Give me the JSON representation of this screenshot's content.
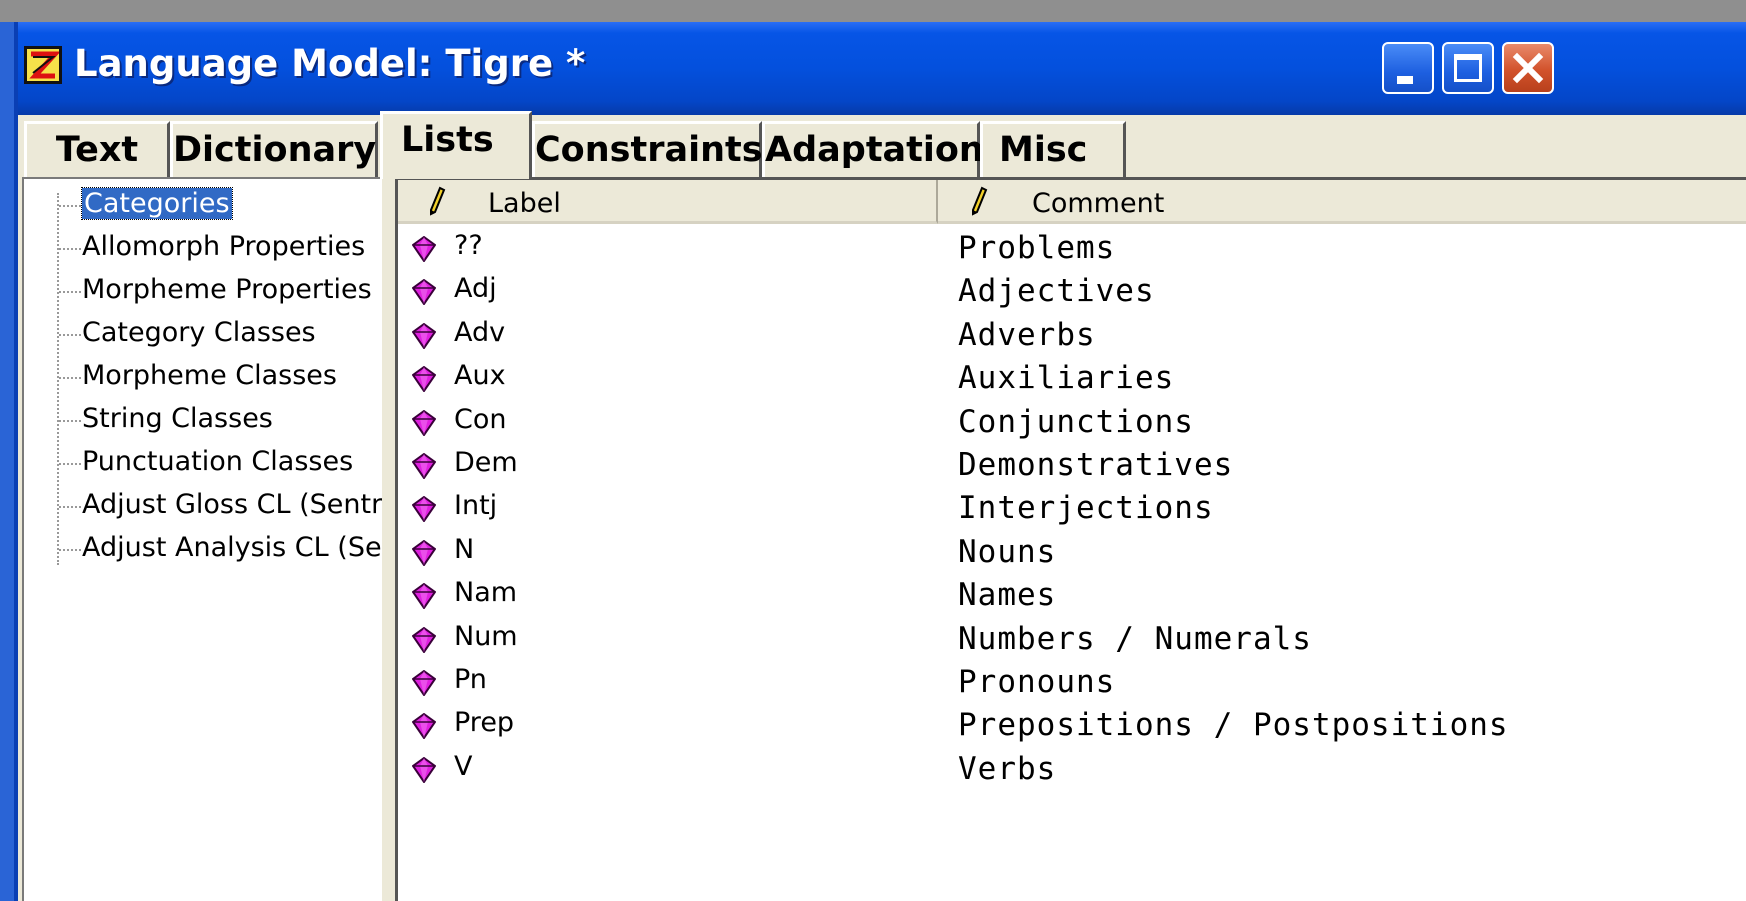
{
  "window": {
    "title": "Language Model: Tigre *",
    "buttons": {
      "minimize": "minimize",
      "maximize": "maximize",
      "close": "close"
    }
  },
  "tabs": [
    {
      "label": "Text",
      "active": false
    },
    {
      "label": "Dictionary",
      "active": false
    },
    {
      "label": "Lists",
      "active": true
    },
    {
      "label": "Constraints",
      "active": false
    },
    {
      "label": "Adaptation",
      "active": false
    },
    {
      "label": "Misc",
      "active": false
    }
  ],
  "tree": {
    "selected": "Categories",
    "items": [
      "Categories",
      "Allomorph Properties",
      "Morpheme Properties",
      "Category Classes",
      "Morpheme Classes",
      "String Classes",
      "Punctuation Classes",
      "Adjust Gloss CL (Sentra",
      "Adjust Analysis CL (Ser"
    ]
  },
  "list": {
    "columns": {
      "label": "Label",
      "comment": "Comment"
    },
    "rows": [
      {
        "label": "??",
        "comment": "Problems"
      },
      {
        "label": "Adj",
        "comment": "Adjectives"
      },
      {
        "label": "Adv",
        "comment": "Adverbs"
      },
      {
        "label": "Aux",
        "comment": "Auxiliaries"
      },
      {
        "label": "Con",
        "comment": "Conjunctions"
      },
      {
        "label": "Dem",
        "comment": "Demonstratives"
      },
      {
        "label": "Intj",
        "comment": "Interjections"
      },
      {
        "label": "N",
        "comment": "Nouns"
      },
      {
        "label": "Nam",
        "comment": "Names"
      },
      {
        "label": "Num",
        "comment": "Numbers / Numerals"
      },
      {
        "label": "Pn",
        "comment": "Pronouns"
      },
      {
        "label": "Prep",
        "comment": "Prepositions / Postpositions"
      },
      {
        "label": "V",
        "comment": "Verbs"
      }
    ]
  },
  "colors": {
    "titlebar": "#0450dd",
    "selection": "#316ac5",
    "gem": "#e020e0",
    "chrome": "#ece9d8"
  },
  "icons": {
    "app": "zoom-z-icon",
    "row": "magenta-gem-icon",
    "column_header": "pencil-icon"
  }
}
